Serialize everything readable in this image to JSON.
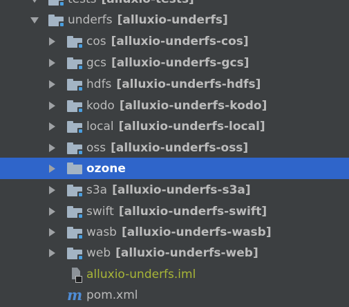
{
  "tree": {
    "top_partial": {
      "name": "tests",
      "module": "[alluxio-tests]"
    },
    "parent": {
      "name": "underfs",
      "module": "[alluxio-underfs]"
    },
    "children": [
      {
        "name": "cos",
        "module": "[alluxio-underfs-cos]"
      },
      {
        "name": "gcs",
        "module": "[alluxio-underfs-gcs]"
      },
      {
        "name": "hdfs",
        "module": "[alluxio-underfs-hdfs]"
      },
      {
        "name": "kodo",
        "module": "[alluxio-underfs-kodo]"
      },
      {
        "name": "local",
        "module": "[alluxio-underfs-local]"
      },
      {
        "name": "oss",
        "module": "[alluxio-underfs-oss]"
      },
      {
        "name": "ozone",
        "module": ""
      },
      {
        "name": "s3a",
        "module": "[alluxio-underfs-s3a]"
      },
      {
        "name": "swift",
        "module": "[alluxio-underfs-swift]"
      },
      {
        "name": "wasb",
        "module": "[alluxio-underfs-wasb]"
      },
      {
        "name": "web",
        "module": "[alluxio-underfs-web]"
      }
    ],
    "files": [
      {
        "name": "alluxio-underfs.iml",
        "icon": "iml-file-icon"
      },
      {
        "name": "pom.xml",
        "icon": "maven-icon"
      }
    ],
    "selected": "ozone"
  },
  "colors": {
    "background": "#3c3f41",
    "selection": "#2f65ca",
    "text": "#bbbbbb",
    "iml_text": "#a8b637",
    "folder": "#a3b4c4",
    "module_badge": "#4a9fe0",
    "maven": "#4f8dd6"
  }
}
